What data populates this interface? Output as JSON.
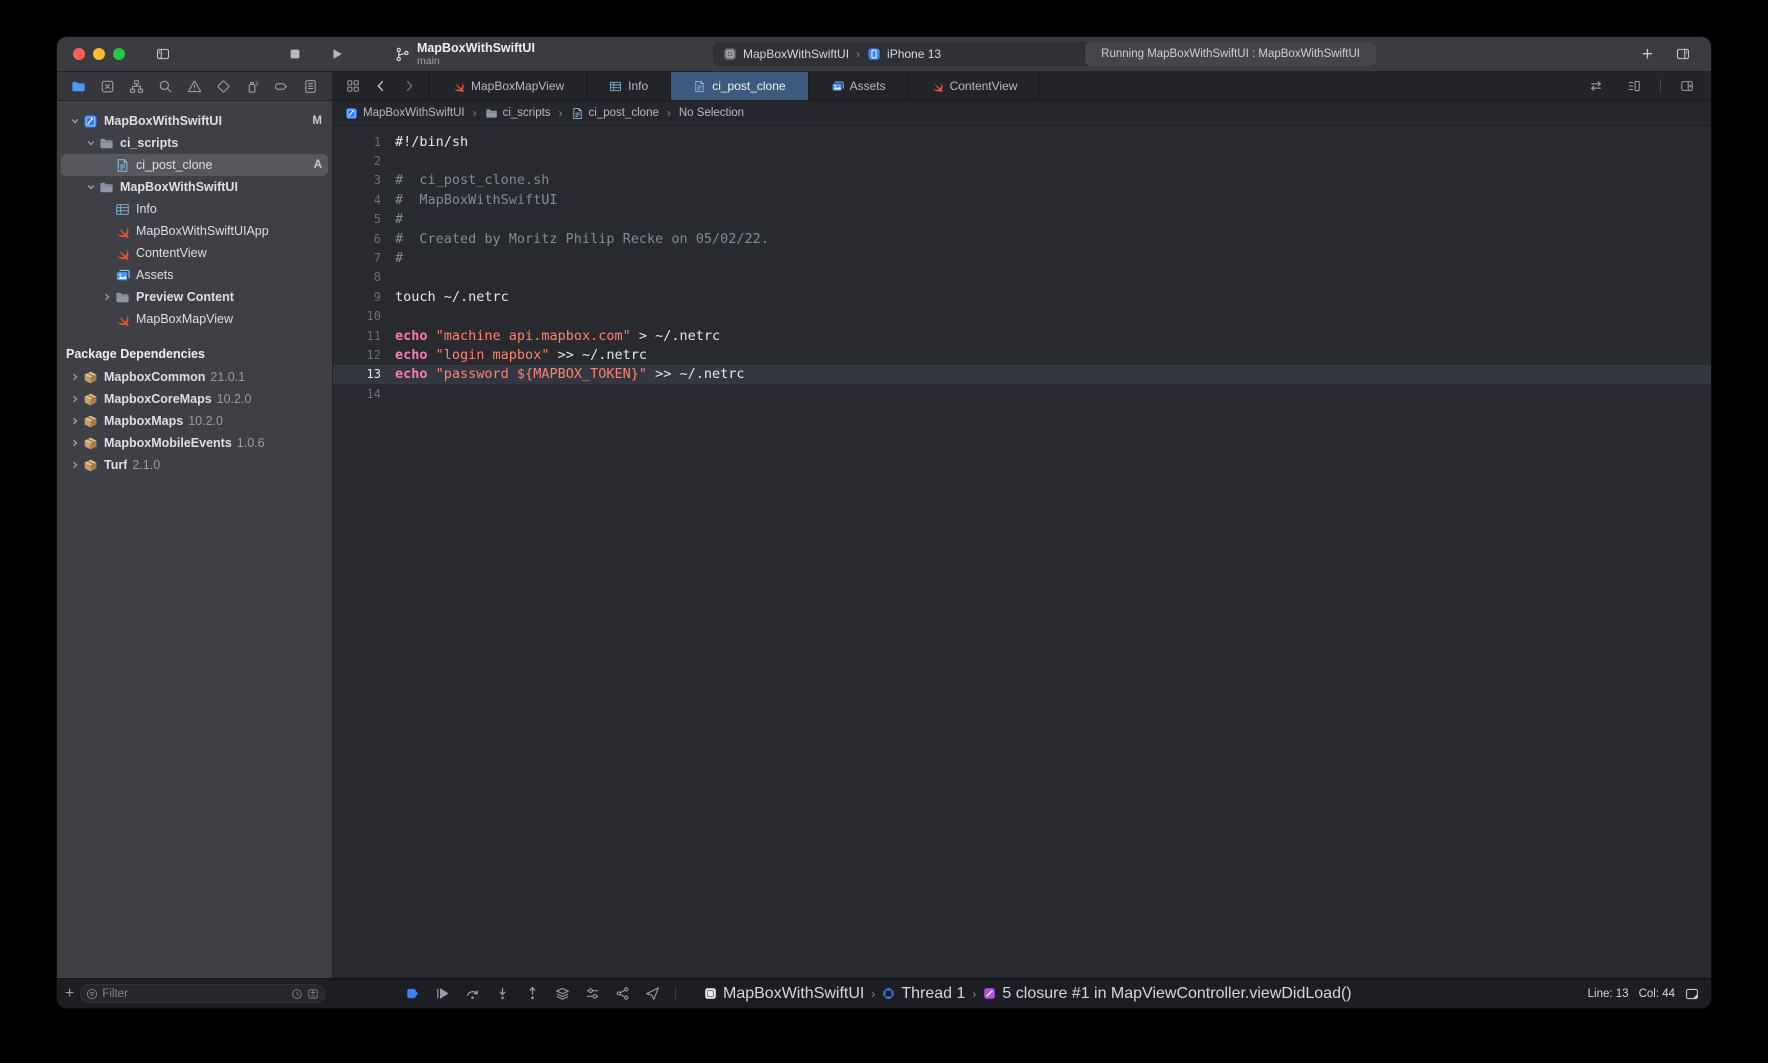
{
  "window": {
    "title": "MapBoxWithSwiftUI",
    "subtitle": "main"
  },
  "toolbar": {
    "scheme": {
      "project": "MapBoxWithSwiftUI",
      "destination": "iPhone 13"
    },
    "status": "Running MapBoxWithSwiftUI : MapBoxWithSwiftUI"
  },
  "navigator": {
    "items": [
      {
        "name": "project-navigator",
        "icon": "folder",
        "active": true
      },
      {
        "name": "source-control-navigator",
        "icon": "xsquare",
        "active": false
      },
      {
        "name": "symbol-navigator",
        "icon": "orgchart",
        "active": false
      },
      {
        "name": "find-navigator",
        "icon": "magnifier",
        "active": false
      },
      {
        "name": "issue-navigator",
        "icon": "warning",
        "active": false
      },
      {
        "name": "test-navigator",
        "icon": "diamond",
        "active": false
      },
      {
        "name": "debug-navigator",
        "icon": "spray",
        "active": false
      },
      {
        "name": "breakpoint-navigator",
        "icon": "capsule",
        "active": false
      },
      {
        "name": "report-navigator",
        "icon": "listdoc",
        "active": false
      }
    ]
  },
  "tabs": [
    {
      "label": "MapBoxMapView",
      "icon": "swift",
      "active": false
    },
    {
      "label": "Info",
      "icon": "plist",
      "active": false
    },
    {
      "label": "ci_post_clone",
      "icon": "scriptfile",
      "active": true
    },
    {
      "label": "Assets",
      "icon": "assets",
      "active": false
    },
    {
      "label": "ContentView",
      "icon": "swift",
      "active": false
    }
  ],
  "breadcrumb": [
    {
      "label": "MapBoxWithSwiftUI",
      "icon": "project"
    },
    {
      "label": "ci_scripts",
      "icon": "folder-small"
    },
    {
      "label": "ci_post_clone",
      "icon": "scriptfile"
    },
    {
      "label": "No Selection",
      "icon": null
    }
  ],
  "sidebar": {
    "tree": [
      {
        "label": "MapBoxWithSwiftUI",
        "icon": "project",
        "indent": 0,
        "chevron": "down",
        "bold": true,
        "badge": "M",
        "selected": false
      },
      {
        "label": "ci_scripts",
        "icon": "folder-small",
        "indent": 1,
        "chevron": "down",
        "bold": true,
        "badge": "",
        "selected": false
      },
      {
        "label": "ci_post_clone",
        "icon": "scriptfile",
        "indent": 2,
        "chevron": "",
        "bold": false,
        "badge": "A",
        "selected": true
      },
      {
        "label": "MapBoxWithSwiftUI",
        "icon": "folder-small",
        "indent": 1,
        "chevron": "down",
        "bold": true,
        "badge": "",
        "selected": false
      },
      {
        "label": "Info",
        "icon": "plist",
        "indent": 2,
        "chevron": "",
        "bold": false,
        "badge": "",
        "selected": false
      },
      {
        "label": "MapBoxWithSwiftUIApp",
        "icon": "swift",
        "indent": 2,
        "chevron": "",
        "bold": false,
        "badge": "",
        "selected": false
      },
      {
        "label": "ContentView",
        "icon": "swift",
        "indent": 2,
        "chevron": "",
        "bold": false,
        "badge": "",
        "selected": false
      },
      {
        "label": "Assets",
        "icon": "assets",
        "indent": 2,
        "chevron": "",
        "bold": false,
        "badge": "",
        "selected": false
      },
      {
        "label": "Preview Content",
        "icon": "folder-small",
        "indent": 2,
        "chevron": "right",
        "bold": true,
        "badge": "",
        "selected": false
      },
      {
        "label": "MapBoxMapView",
        "icon": "swift",
        "indent": 2,
        "chevron": "",
        "bold": false,
        "badge": "",
        "selected": false
      }
    ],
    "section_header": "Package Dependencies",
    "packages": [
      {
        "name": "MapboxCommon",
        "version": "21.0.1"
      },
      {
        "name": "MapboxCoreMaps",
        "version": "10.2.0"
      },
      {
        "name": "MapboxMaps",
        "version": "10.2.0"
      },
      {
        "name": "MapboxMobileEvents",
        "version": "1.0.6"
      },
      {
        "name": "Turf",
        "version": "2.1.0"
      }
    ],
    "filter": {
      "placeholder": "Filter"
    }
  },
  "editor": {
    "lines": [
      {
        "n": "1",
        "current": false,
        "segs": [
          {
            "c": "plain",
            "t": "#!/bin/sh"
          }
        ]
      },
      {
        "n": "2",
        "current": false,
        "segs": []
      },
      {
        "n": "3",
        "current": false,
        "segs": [
          {
            "c": "comment",
            "t": "#  ci_post_clone.sh"
          }
        ]
      },
      {
        "n": "4",
        "current": false,
        "segs": [
          {
            "c": "comment",
            "t": "#  MapBoxWithSwiftUI"
          }
        ]
      },
      {
        "n": "5",
        "current": false,
        "segs": [
          {
            "c": "comment",
            "t": "#"
          }
        ]
      },
      {
        "n": "6",
        "current": false,
        "segs": [
          {
            "c": "comment",
            "t": "#  Created by Moritz Philip Recke on 05/02/22."
          }
        ]
      },
      {
        "n": "7",
        "current": false,
        "segs": [
          {
            "c": "comment",
            "t": "#"
          }
        ]
      },
      {
        "n": "8",
        "current": false,
        "segs": []
      },
      {
        "n": "9",
        "current": false,
        "segs": [
          {
            "c": "plain",
            "t": "touch ~/.netrc"
          }
        ]
      },
      {
        "n": "10",
        "current": false,
        "segs": []
      },
      {
        "n": "11",
        "current": false,
        "segs": [
          {
            "c": "keyword",
            "t": "echo"
          },
          {
            "c": "plain",
            "t": " "
          },
          {
            "c": "string",
            "t": "\"machine api.mapbox.com\""
          },
          {
            "c": "plain",
            "t": " > ~/.netrc"
          }
        ]
      },
      {
        "n": "12",
        "current": false,
        "segs": [
          {
            "c": "keyword",
            "t": "echo"
          },
          {
            "c": "plain",
            "t": " "
          },
          {
            "c": "string",
            "t": "\"login mapbox\""
          },
          {
            "c": "plain",
            "t": " >> ~/.netrc"
          }
        ]
      },
      {
        "n": "13",
        "current": true,
        "segs": [
          {
            "c": "keyword",
            "t": "echo"
          },
          {
            "c": "plain",
            "t": " "
          },
          {
            "c": "string",
            "t": "\"password ${MAPBOX_TOKEN}\""
          },
          {
            "c": "plain",
            "t": " >> ~/.netrc"
          }
        ]
      },
      {
        "n": "14",
        "current": false,
        "segs": []
      }
    ]
  },
  "debugbar": {
    "controls": [
      {
        "name": "breakpoints-toggle",
        "icon": "breakpoint-tag",
        "blue": true
      },
      {
        "name": "continue-button",
        "icon": "continue",
        "blue": false
      },
      {
        "name": "step-over-button",
        "icon": "step-over",
        "blue": false
      },
      {
        "name": "step-into-button",
        "icon": "step-into",
        "blue": false
      },
      {
        "name": "step-out-button",
        "icon": "step-out",
        "blue": false
      },
      {
        "name": "debug-view-hierarchy-button",
        "icon": "view-hierarchy",
        "blue": false
      },
      {
        "name": "environment-overrides-button",
        "icon": "environment",
        "blue": false
      },
      {
        "name": "memory-graph-button",
        "icon": "memory-graph",
        "blue": false
      },
      {
        "name": "simulate-location-button",
        "icon": "location",
        "blue": false
      }
    ],
    "app": "MapBoxWithSwiftUI",
    "thread": "Thread 1",
    "frame": "5 closure #1 in MapViewController.viewDidLoad()",
    "line": "Line: 13",
    "col": "Col: 44"
  },
  "colors": {
    "accent_blue": "#4d9bf8",
    "active_tab": "#3e5a80",
    "swift_orange": "#f05138",
    "keyword_pink": "#ff7ab2",
    "string_salmon": "#ff8170",
    "comment_gray": "#7f8c98"
  }
}
